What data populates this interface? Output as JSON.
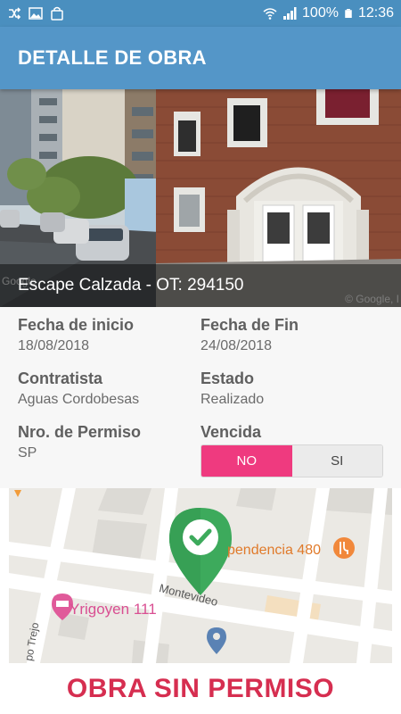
{
  "status_bar": {
    "battery": "100%",
    "time": "12:36",
    "left_icons": [
      "shuffle-icon",
      "image-icon",
      "bag-icon"
    ],
    "right_icons": [
      "wifi-icon",
      "signal-icon",
      "battery-icon"
    ]
  },
  "app_bar": {
    "title": "DETALLE DE OBRA"
  },
  "photo": {
    "caption": "Escape Calzada - OT: 294150",
    "watermark_left": "Google",
    "watermark_right": "© Google, I"
  },
  "details": {
    "fecha_inicio": {
      "label": "Fecha de inicio",
      "value": "18/08/2018"
    },
    "fecha_fin": {
      "label": "Fecha de Fin",
      "value": "24/08/2018"
    },
    "contratista": {
      "label": "Contratista",
      "value": "Aguas Cordobesas"
    },
    "estado": {
      "label": "Estado",
      "value": "Realizado"
    },
    "permiso": {
      "label": "Nro. de Permiso",
      "value": "SP"
    },
    "vencida": {
      "label": "Vencida",
      "options": [
        "NO",
        "SI"
      ],
      "selected": "NO"
    }
  },
  "map": {
    "labels": {
      "poi_right": "pendencia 480",
      "hotel": "Yrigoyen 111",
      "street_center": "Montevideo",
      "street_left": "po Trejo"
    },
    "marker_icon": "check-marker-icon"
  },
  "footer": {
    "text": "OBRA SIN PERMISO"
  },
  "colors": {
    "status_bar": "#4a8fbf",
    "app_bar": "#5496c8",
    "toggle_active": "#ef3a7f",
    "footer_text": "#d62e50",
    "marker": "#3daa5c"
  }
}
